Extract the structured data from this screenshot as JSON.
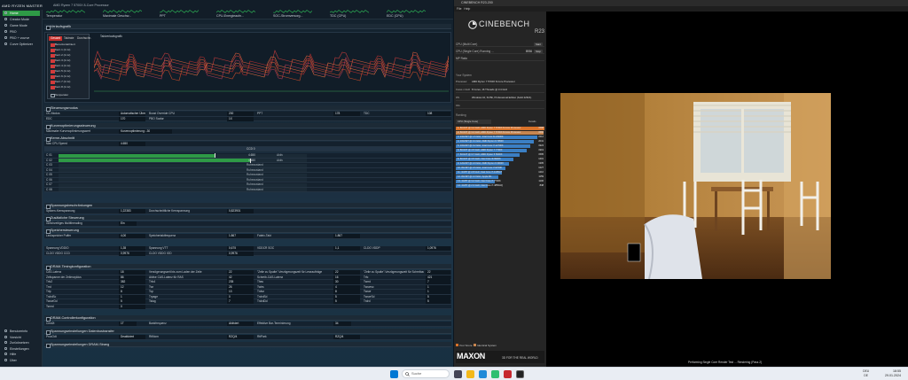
{
  "ryzen_master": {
    "logo": "AMD RYZEN MASTER",
    "subtitle": "AMD Ryzen 7 5700X 8-Core Processor",
    "metrics": [
      {
        "label": "Temperatur"
      },
      {
        "label": "Maximale Geschw..."
      },
      {
        "label": "PPT"
      },
      {
        "label": "CPU-Energieaufn..."
      },
      {
        "label": "SOC-Stromversorg..."
      },
      {
        "label": "TDC (CPU)"
      },
      {
        "label": "EDC (CPU)"
      }
    ],
    "sidebar": {
      "items": [
        "Home",
        "Creator Mode",
        "Game Mode",
        "PBO",
        "PBO + vcurve",
        "Curve Optimizer"
      ],
      "bottom": [
        "Benutzerinfo",
        "Vorsicht",
        "Zurücksetzen",
        "Einstellungen",
        "Hilfe",
        "Über"
      ]
    },
    "sections": {
      "graph": "Verlaufsgrafik",
      "graph_title": "Taktverlaufsgrafik",
      "graph_popup_tabs": [
        "Gesamt",
        "Taktrate",
        "Durchschn."
      ],
      "graph_popup_items": [
        "Benutzerdefiniert",
        "Kern 1 (1.1x)",
        "Kern 2 (1.1x)",
        "Kern 3 (1.1x)",
        "Kern 4 (1.1x)",
        "Kern 5 (1.1x)",
        "Kern 6 (1.1x)",
        "Kern 7 (1.1x)",
        "Kern 8 (1.1x)",
        "Temperatur"
      ],
      "control": "Steuerungsmodus",
      "limits": "Kurvenoptimierungssteuerung",
      "kern": "Kerne-Abschnitt",
      "core_table": "Spannungsbeschränkungen",
      "voltage": "Zusätzliche Steuerung",
      "mem": "Speichersteuerung",
      "dram": "DRAM-Timingkonfiguration",
      "dram2": "DRAM-Controllerkonfiguration",
      "bottom1": "Spannungseinstellungen Datenbustransfer",
      "bottom2": "Spannungseinstellungen DRAM-Strang"
    },
    "control_rows": [
      {
        "a": "OC-Modus",
        "av": "Automatischer Übertakt...",
        "b": "Boost Override CPU",
        "bv": "200",
        "c": "PPT",
        "cv": "178",
        "d": "TDC",
        "dv": "108"
      },
      {
        "a": "EDC",
        "av": "170",
        "b": "PBO Scalar",
        "bv": "1X",
        "c": "",
        "cv": "",
        "d": "",
        "dv": ""
      }
    ],
    "kern_row": {
      "a": "Maximaler Kurvenoptimierungswert",
      "av": "Kurvenoptimierung: -30"
    },
    "core_header": {
      "a": "Max CPU Speed",
      "av": "4.650",
      "title": "CCD 0"
    },
    "cores": [
      {
        "label": "C 01",
        "fill": 0.63,
        "val": "4.650",
        "state": "Aktiv"
      },
      {
        "label": "C 02",
        "fill": 0.77,
        "val": "4.650",
        "state": "Aktiv"
      },
      {
        "label": "C 03",
        "fill": 0.0,
        "val": "",
        "state": "Ruhezustand"
      },
      {
        "label": "C 04",
        "fill": 0.0,
        "val": "",
        "state": "Ruhezustand"
      },
      {
        "label": "C 05",
        "fill": 0.0,
        "val": "",
        "state": "Ruhezustand"
      },
      {
        "label": "C 06",
        "fill": 0.0,
        "val": "",
        "state": "Ruhezustand"
      },
      {
        "label": "C 07",
        "fill": 0.0,
        "val": "",
        "state": "Ruhezustand"
      },
      {
        "label": "C 08",
        "fill": 0.0,
        "val": "",
        "state": "Ruhezustand"
      }
    ],
    "voltage_row": {
      "a": "Spitzen-Kernspannung",
      "av": "1,22383",
      "b": "Durchschnittliche Kernspannung",
      "bv": "0,823901"
    },
    "extra_row": {
      "a": "Gleichzeitiges Multithreading",
      "av": "Ein"
    },
    "mem_row": {
      "a": "Leckspeicher Puffer",
      "av": "4,00",
      "b": "Speichertaktfrequenz",
      "bv": "1.867",
      "c": "Fabric-Takt",
      "cv": "1.867"
    },
    "mem_rows2": [
      {
        "a": "Spannung VDDIO",
        "av": "1,35",
        "b": "Spannung VTT",
        "bv": "0,675",
        "c": "VDDCR SOC",
        "cv": "1,1",
        "d": "CLDO VDDP",
        "dv": "1,0976"
      },
      {
        "a": "CLDO VDDG CCD",
        "av": "0,9976",
        "b": "CLDO VDDG IOD",
        "bv": "0,9976",
        "c": "",
        "cv": "",
        "d": "",
        "dv": ""
      }
    ],
    "dram_rows": [
      {
        "a": "CAS-Latenz",
        "av": "18",
        "b": "Verzögerungszeit bis zum Laden der Zeile",
        "bv": "22",
        "c": "\"Zeile zu Spalte\"-Verzögerungszeit für Leseaufträge",
        "cv": "22",
        "d": "\"Zeile zu Spalte\"-Verzögerungszeit für Schreibaufträge",
        "dv": "22"
      },
      {
        "a": "Zeitspanne der Zeilenzyklus",
        "av": "86",
        "b": "Aktive CAS-Latenz für RAS",
        "bv": "42",
        "c": "Schreib-CAS-Latenz",
        "cv": "16",
        "d": "Trfc",
        "dv": "421"
      },
      {
        "a": "Trfc2",
        "av": "382",
        "b": "Trfc4",
        "bv": "235",
        "c": "Tfaw",
        "cv": "30",
        "d": "Twrrd",
        "dv": "7"
      },
      {
        "a": "Trrd",
        "av": "12",
        "b": "Twr",
        "bv": "26",
        "c": "Twtrs",
        "cv": "4",
        "d": "Twrwrsc",
        "dv": "1"
      },
      {
        "a": "Trtp",
        "av": "8",
        "b": "Tcp",
        "bv": "13",
        "c": "Trdwr",
        "cv": "8",
        "d": "Twrwr",
        "dv": "1"
      },
      {
        "a": "TrdrdSc",
        "av": "1",
        "b": "Trpage",
        "bv": "0",
        "c": "TrdrdSd",
        "cv": "5",
        "d": "TwrwrSd",
        "dv": "5"
      },
      {
        "a": "TwrwrDd",
        "av": "5",
        "b": "Tstag",
        "bv": "7",
        "c": "TrdrdDd",
        "cv": "5",
        "d": "Trdrd",
        "dv": "5"
      },
      {
        "a": "Tsmrd",
        "av": "0",
        "b": "",
        "bv": "",
        "c": "",
        "cv": "",
        "d": "",
        "dv": ""
      }
    ],
    "dram2_row": {
      "a": "Cmd2t",
      "av": "1T",
      "b": "Bankfrequenz",
      "bv": "Aktiviert",
      "c": "Effektive Bar-Terminierung",
      "cv": "34"
    },
    "bottom_row": {
      "a": "ProcOdt",
      "av": "Deaktiviert",
      "b": "RttNom",
      "bv": "RZQ/4",
      "c": "RttPark",
      "cv": "RZQ/4"
    }
  },
  "cinebench": {
    "window_title": "CINEBENCH R23.200",
    "menu": [
      "File",
      "Help"
    ],
    "logo_name": "CINEBENCH",
    "logo_ver": "R23",
    "tests": [
      {
        "label": "CPU (Multi Core)",
        "value": "",
        "btn": "Start"
      },
      {
        "label": "CPU (Single Core)  Running ...",
        "value": "8936",
        "btn": "Stop"
      },
      {
        "label": "MP Ratio",
        "value": "",
        "btn": ""
      }
    ],
    "system_label": "Your System",
    "system": [
      {
        "k": "Processor",
        "v": "AMD Ryzen 7 5700X 8-Core Processor"
      },
      {
        "k": "Cores x GHz",
        "v": "8 Cores, 16 Threads @ 3.4 GHz"
      },
      {
        "k": "OS",
        "v": "Windows 10, 64 Bit, Professional Edition (build 22621)"
      },
      {
        "k": "Info",
        "v": ""
      }
    ],
    "ranking_label": "Ranking",
    "ranking_select": "CPU (Single Core)",
    "ranking_details": "Details",
    "ranking": [
      {
        "t": "1. 8C/16T @ 3.4 GHz, AMD Ryzen 7 5700X 8-Core Processor",
        "s": "1588",
        "color": "#d8722a",
        "w": 1.0
      },
      {
        "t": "2. 8C/16T @ 3.4 GHz, AMD Ryzen 7 5700X 8-Core Processor",
        "s": "1584",
        "color": "#c88650",
        "w": 0.99
      },
      {
        "t": "3. 24C/32T @ 1.6 GHz, Intel Core i9-13900K",
        "s": "2212",
        "color": "#3b7fc4",
        "w": 0.92
      },
      {
        "t": "4. 16C/32T @ 3.4 GHz, AMD Ryzen 9 7950X",
        "s": "2041",
        "color": "#3b7fc4",
        "w": 0.88
      },
      {
        "t": "5. 16C/24T @ 3.2 GHz, Intel Core i7-12700K",
        "s": "1924",
        "color": "#3b7fc4",
        "w": 0.84
      },
      {
        "t": "6. 8C/16T @ 4.5 GHz, AMD Ryzen 7 7700X",
        "s": "1919",
        "color": "#3b7fc4",
        "w": 0.8
      },
      {
        "t": "7. 6C/12T @ 3.7 GHz, AMD Ryzen 5 5600X",
        "s": "1595",
        "color": "#3b7fc4",
        "w": 0.72
      },
      {
        "t": "8. 8C/16T @ 3.5 GHz, Intel Core i9-9900K",
        "s": "1401",
        "color": "#3b7fc4",
        "w": 0.65
      },
      {
        "t": "9. 12C/24T @ 2.9 GHz, AMD Ryzen 9 3900X",
        "s": "1305",
        "color": "#3b7fc4",
        "w": 0.6
      },
      {
        "t": "10. 8C/16T @ 3.6 GHz, Intel Core i7-9700K",
        "s": "1227",
        "color": "#3b7fc4",
        "w": 0.56
      },
      {
        "t": "11. 4C/8T @ 2.8 GHz, Intel Core i7-1165G7",
        "s": "1210",
        "color": "#3b7fc4",
        "w": 0.52
      },
      {
        "t": "12. 8C/16T @ 2.3 GHz, Apple M1",
        "s": "1159",
        "color": "#3b7fc4",
        "w": 0.48
      },
      {
        "t": "13. 4C/8T @ 3.4 GHz, Intel Core i7-7700K",
        "s": "1106",
        "color": "#3b7fc4",
        "w": 0.44
      },
      {
        "t": "14. 4C/8T @ 2.3 GHz, Intel Core i7-4850HQ",
        "s": "848",
        "color": "#3b7fc4",
        "w": 0.36
      }
    ],
    "legend": [
      "Your Score",
      "Identical System"
    ],
    "maxon": "MAXON",
    "tagline": "3D FOR THE REAL WORLD",
    "status": "Performing Single Core Render Test ... Rendering (Pass 2)"
  },
  "taskbar": {
    "search": "Suche",
    "lang": [
      "DEU",
      "DE"
    ],
    "time": "18:55",
    "date": "29.01.2024"
  },
  "colors": {
    "accent_green": "#2e9a46",
    "cb_orange": "#d8722a",
    "cb_blue": "#3b7fc4"
  }
}
